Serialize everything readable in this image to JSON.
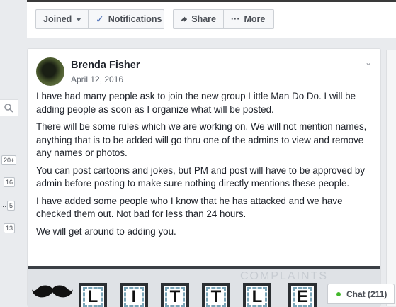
{
  "group_actions": {
    "joined_label": "Joined",
    "notifications_label": "Notifications",
    "share_label": "Share",
    "more_label": "More"
  },
  "left_rail": {
    "counts": [
      "20+",
      "16",
      "5",
      "13"
    ],
    "ellipsis": "..."
  },
  "post": {
    "author": "Brenda Fisher",
    "date": "April 12, 2016",
    "paragraphs": [
      "I have had many people ask to join the new group Little Man Do Do. I will be adding people as soon as I organize what will be posted.",
      "There will be some rules which we are working on. We will not mention names, anything that is to be added will go thru one of the admins to view and remove any names or photos.",
      "You can post cartoons and jokes, but PM and post will have to be approved by admin before posting to make sure nothing directly mentions these people.",
      "I have added some people who I know that he has attacked and we have checked them out. Not bad for less than 24 hours.",
      "We will get around to adding you."
    ],
    "banner_letters": [
      "L",
      "I",
      "T",
      "T",
      "L",
      "E"
    ],
    "banner_watermark": "COMPLAINTS"
  },
  "chat": {
    "label": "Chat (211)"
  },
  "colors": {
    "page_bg": "#e9ebee",
    "brand_blue": "#4267b2",
    "online_green": "#42b72a"
  }
}
